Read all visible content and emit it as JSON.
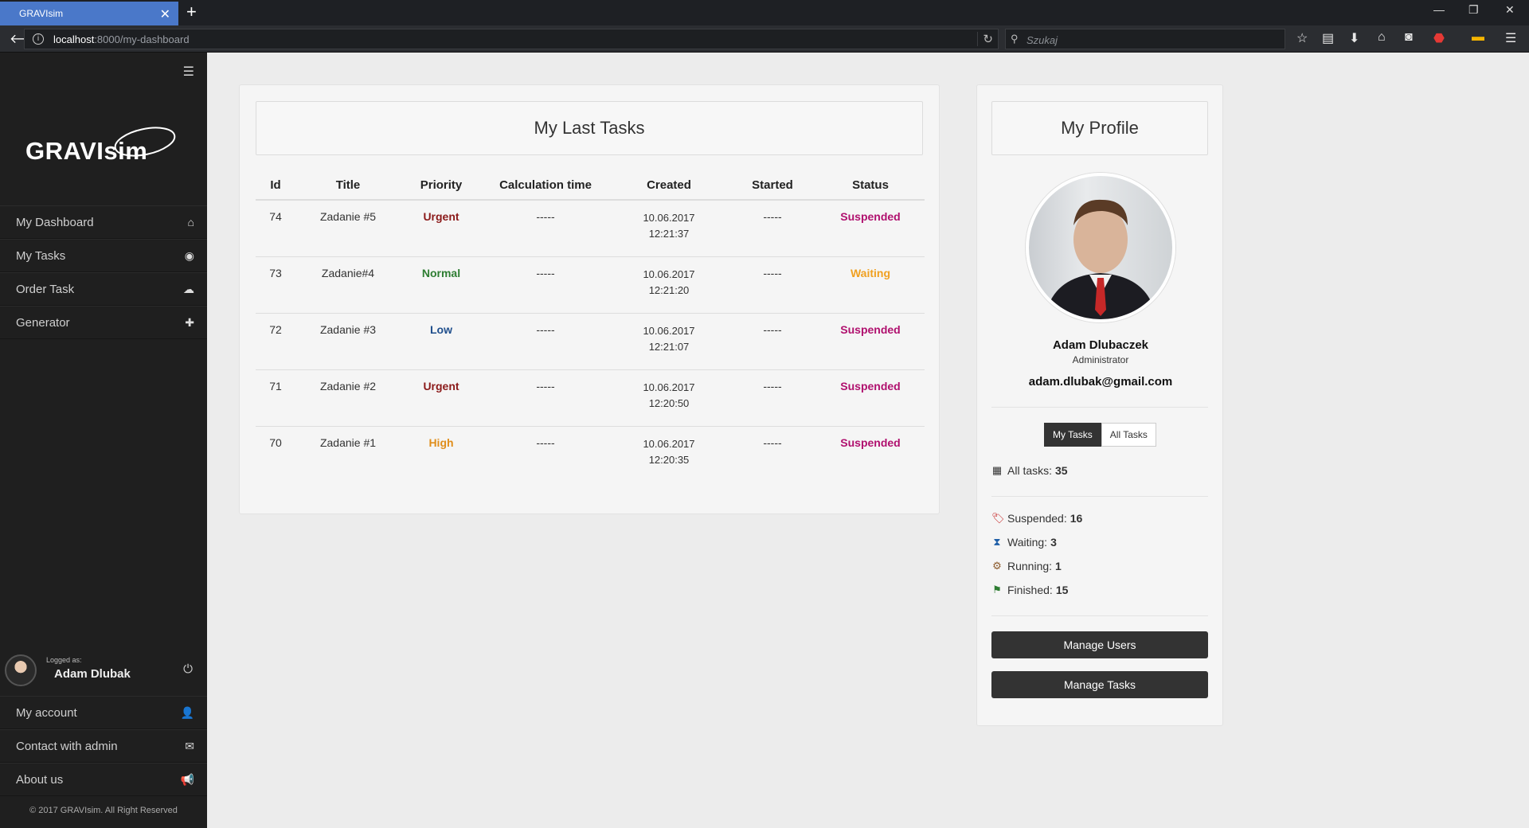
{
  "browser": {
    "tab_title": "GRAVIsim",
    "url_host": "localhost",
    "url_path": ":8000/my-dashboard",
    "search_placeholder": "Szukaj",
    "new_tab_label": "+"
  },
  "sidebar": {
    "logo": "GRAVIsim",
    "items": [
      {
        "label": "My Dashboard",
        "icon": "home-icon"
      },
      {
        "label": "My Tasks",
        "icon": "eye-icon"
      },
      {
        "label": "Order Task",
        "icon": "cloud-upload-icon"
      },
      {
        "label": "Generator",
        "icon": "plus-icon"
      }
    ],
    "logged_label": "Logged as:",
    "logged_name": "Adam Dlubak",
    "bottom_items": [
      {
        "label": "My account",
        "icon": "user-icon"
      },
      {
        "label": "Contact with admin",
        "icon": "envelope-icon"
      },
      {
        "label": "About us",
        "icon": "megaphone-icon"
      }
    ],
    "copyright": "© 2017 GRAVIsim. All Right Reserved"
  },
  "tasks": {
    "title": "My Last Tasks",
    "columns": [
      "Id",
      "Title",
      "Priority",
      "Calculation time",
      "Created",
      "Started",
      "Status"
    ],
    "rows": [
      {
        "id": "74",
        "title": "Zadanie #5",
        "priority": "Urgent",
        "calc": "-----",
        "date": "10.06.2017",
        "time": "12:21:37",
        "started": "-----",
        "status": "Suspended"
      },
      {
        "id": "73",
        "title": "Zadanie#4",
        "priority": "Normal",
        "calc": "-----",
        "date": "10.06.2017",
        "time": "12:21:20",
        "started": "-----",
        "status": "Waiting"
      },
      {
        "id": "72",
        "title": "Zadanie #3",
        "priority": "Low",
        "calc": "-----",
        "date": "10.06.2017",
        "time": "12:21:07",
        "started": "-----",
        "status": "Suspended"
      },
      {
        "id": "71",
        "title": "Zadanie #2",
        "priority": "Urgent",
        "calc": "-----",
        "date": "10.06.2017",
        "time": "12:20:50",
        "started": "-----",
        "status": "Suspended"
      },
      {
        "id": "70",
        "title": "Zadanie #1",
        "priority": "High",
        "calc": "-----",
        "date": "10.06.2017",
        "time": "12:20:35",
        "started": "-----",
        "status": "Suspended"
      }
    ]
  },
  "colors": {
    "Urgent": "#8b1a1a",
    "Normal": "#2e7d32",
    "Low": "#1f4e8c",
    "High": "#e08e1b",
    "Suspended": "#b0106e",
    "Waiting": "#f0a020"
  },
  "profile": {
    "title": "My Profile",
    "name": "Adam Dlubaczek",
    "role": "Administrator",
    "email": "adam.dlubak@gmail.com",
    "toggle": [
      "My Tasks",
      "All Tasks"
    ],
    "all_tasks_label": "All tasks:",
    "all_tasks_value": "35",
    "stats": [
      {
        "label": "Suspended:",
        "value": "16",
        "icon": "tags-icon"
      },
      {
        "label": "Waiting:",
        "value": "3",
        "icon": "hourglass-icon"
      },
      {
        "label": "Running:",
        "value": "1",
        "icon": "cog-icon"
      },
      {
        "label": "Finished:",
        "value": "15",
        "icon": "flag-icon"
      }
    ],
    "manage_users": "Manage Users",
    "manage_tasks": "Manage Tasks"
  }
}
